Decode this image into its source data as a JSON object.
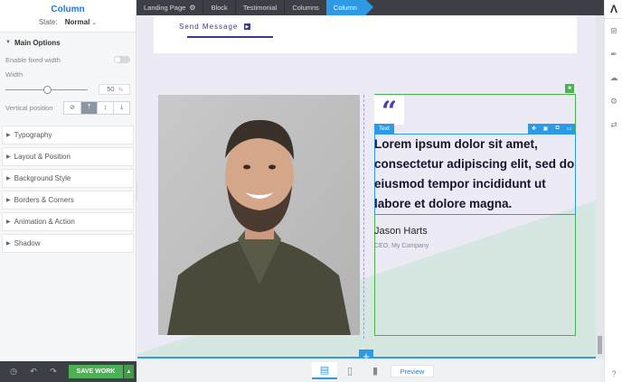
{
  "panel": {
    "title": "Column",
    "state_label": "State:",
    "state_value": "Normal",
    "main_section": "Main Options",
    "fixed_width_label": "Enable fixed width",
    "width_label": "Width",
    "width_value": "50",
    "width_unit": "%",
    "vertical_position_label": "Vertical position",
    "sections": [
      "Typography",
      "Layout & Position",
      "Background Style",
      "Borders & Corners",
      "Animation & Action",
      "Shadow"
    ],
    "save_label": "SAVE WORK"
  },
  "breadcrumb": [
    "Landing Page",
    "Block",
    "Testimonial",
    "Columns",
    "Column"
  ],
  "canvas": {
    "send_message": "Send Message",
    "text_label": "Text",
    "quote": "Lorem ipsum dolor sit amet, consectetur adipiscing elit, sed do eiusmod tempor incididunt ut labore et dolore magna.",
    "author_name": "Jason Harts",
    "author_role": "CEO, My Company"
  },
  "device_bar": {
    "preview_label": "Preview"
  },
  "colors": {
    "accent": "#2d9ae6",
    "save": "#4ab252",
    "brand_quote": "#4a40b5"
  },
  "icons": {
    "right_toolbar": [
      "add-icon",
      "brush-icon",
      "cloud-icon",
      "settings-icon",
      "translate-icon",
      "help-icon"
    ],
    "devices": [
      "desktop-icon",
      "tablet-icon",
      "mobile-icon"
    ]
  }
}
